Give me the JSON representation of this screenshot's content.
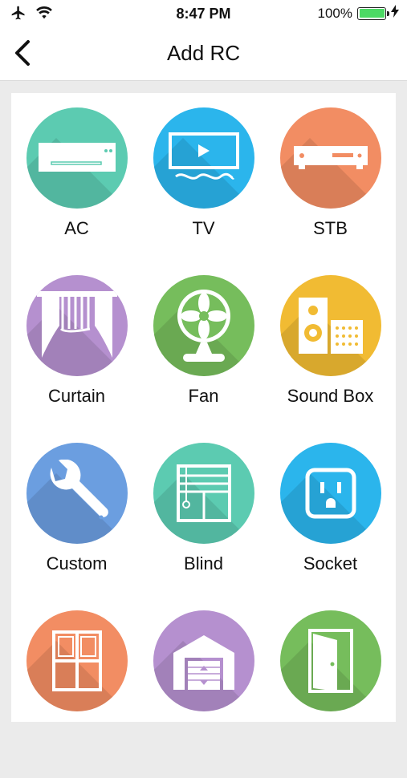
{
  "status_bar": {
    "time": "8:47 PM",
    "battery_percent": "100%",
    "battery_level": 1.0
  },
  "nav": {
    "title": "Add RC",
    "back_icon": "chevron-left-icon"
  },
  "devices": [
    {
      "label": "AC",
      "icon": "air-conditioner-icon",
      "color": "#5ccbb1"
    },
    {
      "label": "TV",
      "icon": "tv-icon",
      "color": "#2bb5ec"
    },
    {
      "label": "STB",
      "icon": "set-top-box-icon",
      "color": "#f28d63"
    },
    {
      "label": "Curtain",
      "icon": "curtain-icon",
      "color": "#b590cf"
    },
    {
      "label": "Fan",
      "icon": "fan-icon",
      "color": "#76bd5c"
    },
    {
      "label": "Sound Box",
      "icon": "speaker-icon",
      "color": "#f1bb33"
    },
    {
      "label": "Custom",
      "icon": "wrench-icon",
      "color": "#6b9ee0"
    },
    {
      "label": "Blind",
      "icon": "blind-icon",
      "color": "#5ccbb1"
    },
    {
      "label": "Socket",
      "icon": "socket-icon",
      "color": "#2bb5ec"
    },
    {
      "label": "",
      "icon": "window-icon",
      "color": "#f28d63"
    },
    {
      "label": "",
      "icon": "garage-door-icon",
      "color": "#b590cf"
    },
    {
      "label": "",
      "icon": "door-icon",
      "color": "#76bd5c"
    }
  ]
}
